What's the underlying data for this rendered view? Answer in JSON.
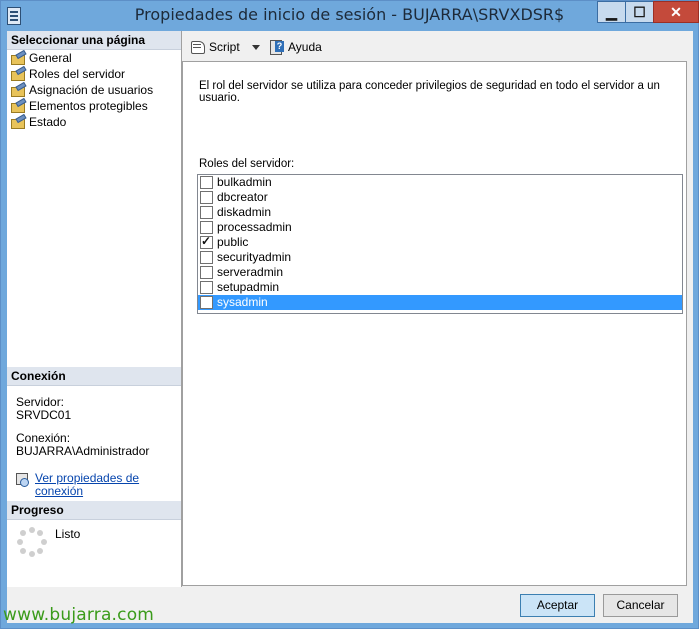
{
  "window": {
    "title": "Propiedades de inicio de sesión - BUJARRA\\SRVXDSR$",
    "minimize": "▁",
    "maximize": "☐",
    "close": "✕"
  },
  "sidebar": {
    "select_page_header": "Seleccionar una página",
    "items": [
      {
        "label": "General"
      },
      {
        "label": "Roles del servidor"
      },
      {
        "label": "Asignación de usuarios"
      },
      {
        "label": "Elementos protegibles"
      },
      {
        "label": "Estado"
      }
    ],
    "connection_header": "Conexión",
    "server_label": "Servidor:",
    "server_value": "SRVDC01",
    "connection_label": "Conexión:",
    "connection_value": "BUJARRA\\Administrador",
    "view_connection_link": "Ver propiedades de conexión",
    "progress_header": "Progreso",
    "progress_status": "Listo"
  },
  "toolbar": {
    "script_label": "Script",
    "help_label": "Ayuda"
  },
  "main": {
    "description": "El rol del servidor se utiliza para conceder privilegios de seguridad en todo el servidor a un usuario.",
    "roles_label": "Roles del servidor:",
    "roles": [
      {
        "name": "bulkadmin",
        "checked": false
      },
      {
        "name": "dbcreator",
        "checked": false
      },
      {
        "name": "diskadmin",
        "checked": false
      },
      {
        "name": "processadmin",
        "checked": false
      },
      {
        "name": "public",
        "checked": true
      },
      {
        "name": "securityadmin",
        "checked": false
      },
      {
        "name": "serveradmin",
        "checked": false
      },
      {
        "name": "setupadmin",
        "checked": false
      },
      {
        "name": "sysadmin",
        "checked": false,
        "selected": true
      }
    ]
  },
  "buttons": {
    "ok": "Aceptar",
    "cancel": "Cancelar"
  },
  "watermark": "www.bujarra.com",
  "colors": {
    "titlebar": "#6fa8dc",
    "selection": "#3399ff",
    "link": "#0645ad",
    "watermark": "#3a9b1a"
  }
}
